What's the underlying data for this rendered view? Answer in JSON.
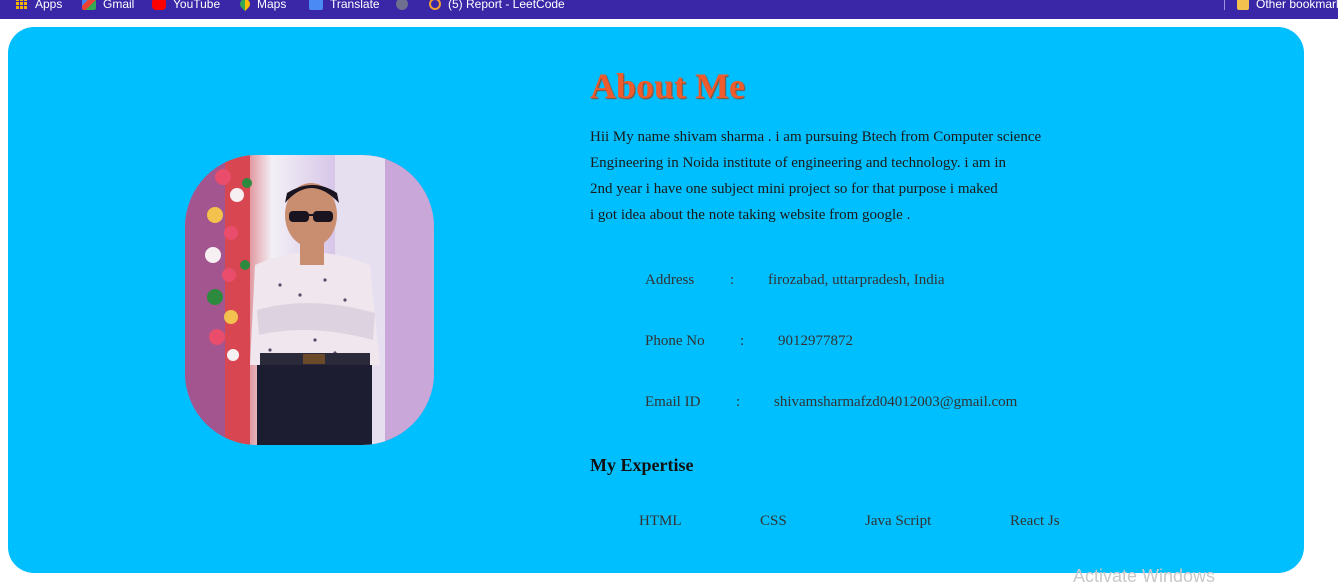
{
  "bookmarks": {
    "items": [
      {
        "label": "Apps"
      },
      {
        "label": "Gmail"
      },
      {
        "label": "YouTube"
      },
      {
        "label": "Maps"
      },
      {
        "label": "Translate"
      },
      {
        "label": ""
      },
      {
        "label": "(5) Report - LeetCode"
      }
    ],
    "other": "Other bookmarks"
  },
  "about": {
    "title": "About Me",
    "bio_lines": [
      "Hii My name shivam sharma . i am pursuing Btech from Computer science",
      "Engineering in Noida institute of engineering and technology. i am in",
      "2nd year i have one subject mini project so for that purpose i maked",
      "i got idea about the note taking website from google ."
    ]
  },
  "info": [
    {
      "label": "Address",
      "sep": ":",
      "value": "firozabad, uttarpradesh, India"
    },
    {
      "label": "Phone No",
      "sep": ":",
      "value": "9012977872"
    },
    {
      "label": "Email ID",
      "sep": ":",
      "value": "shivamsharmafzd04012003@gmail.com"
    }
  ],
  "expertise": {
    "title": "My Expertise",
    "skills": [
      "HTML",
      "CSS",
      "Java Script",
      "React Js"
    ]
  },
  "watermark": "Activate Windows",
  "colors": {
    "card": "#00bfff",
    "title": "#ee5b2c",
    "bookmark_bar": "#3a27a8"
  }
}
